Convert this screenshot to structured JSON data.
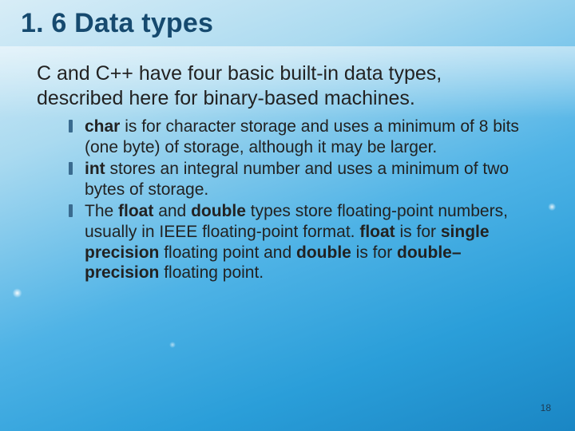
{
  "title": "1. 6 Data types",
  "intro": "C and C++ have four basic built-in data types, described here for binary-based machines.",
  "bullets": [
    {
      "b0": "char",
      "t0": " is for character storage and uses a minimum of 8 bits (one byte) of storage, although it may be larger."
    },
    {
      "b0": "int",
      "t0": " stores an integral number and uses a minimum of two bytes of storage."
    },
    {
      "pre": "The ",
      "b0": "float",
      "mid0": " and ",
      "b1": "double",
      "mid1": " types store floating-point numbers, usually in IEEE floating-point format. ",
      "b2": "float",
      "mid2": " is for ",
      "b3": "single precision",
      "mid3": " floating point and ",
      "b4": "double",
      "mid4": " is for ",
      "b5": "double–precision",
      "tail": " floating point."
    }
  ],
  "page": "18"
}
